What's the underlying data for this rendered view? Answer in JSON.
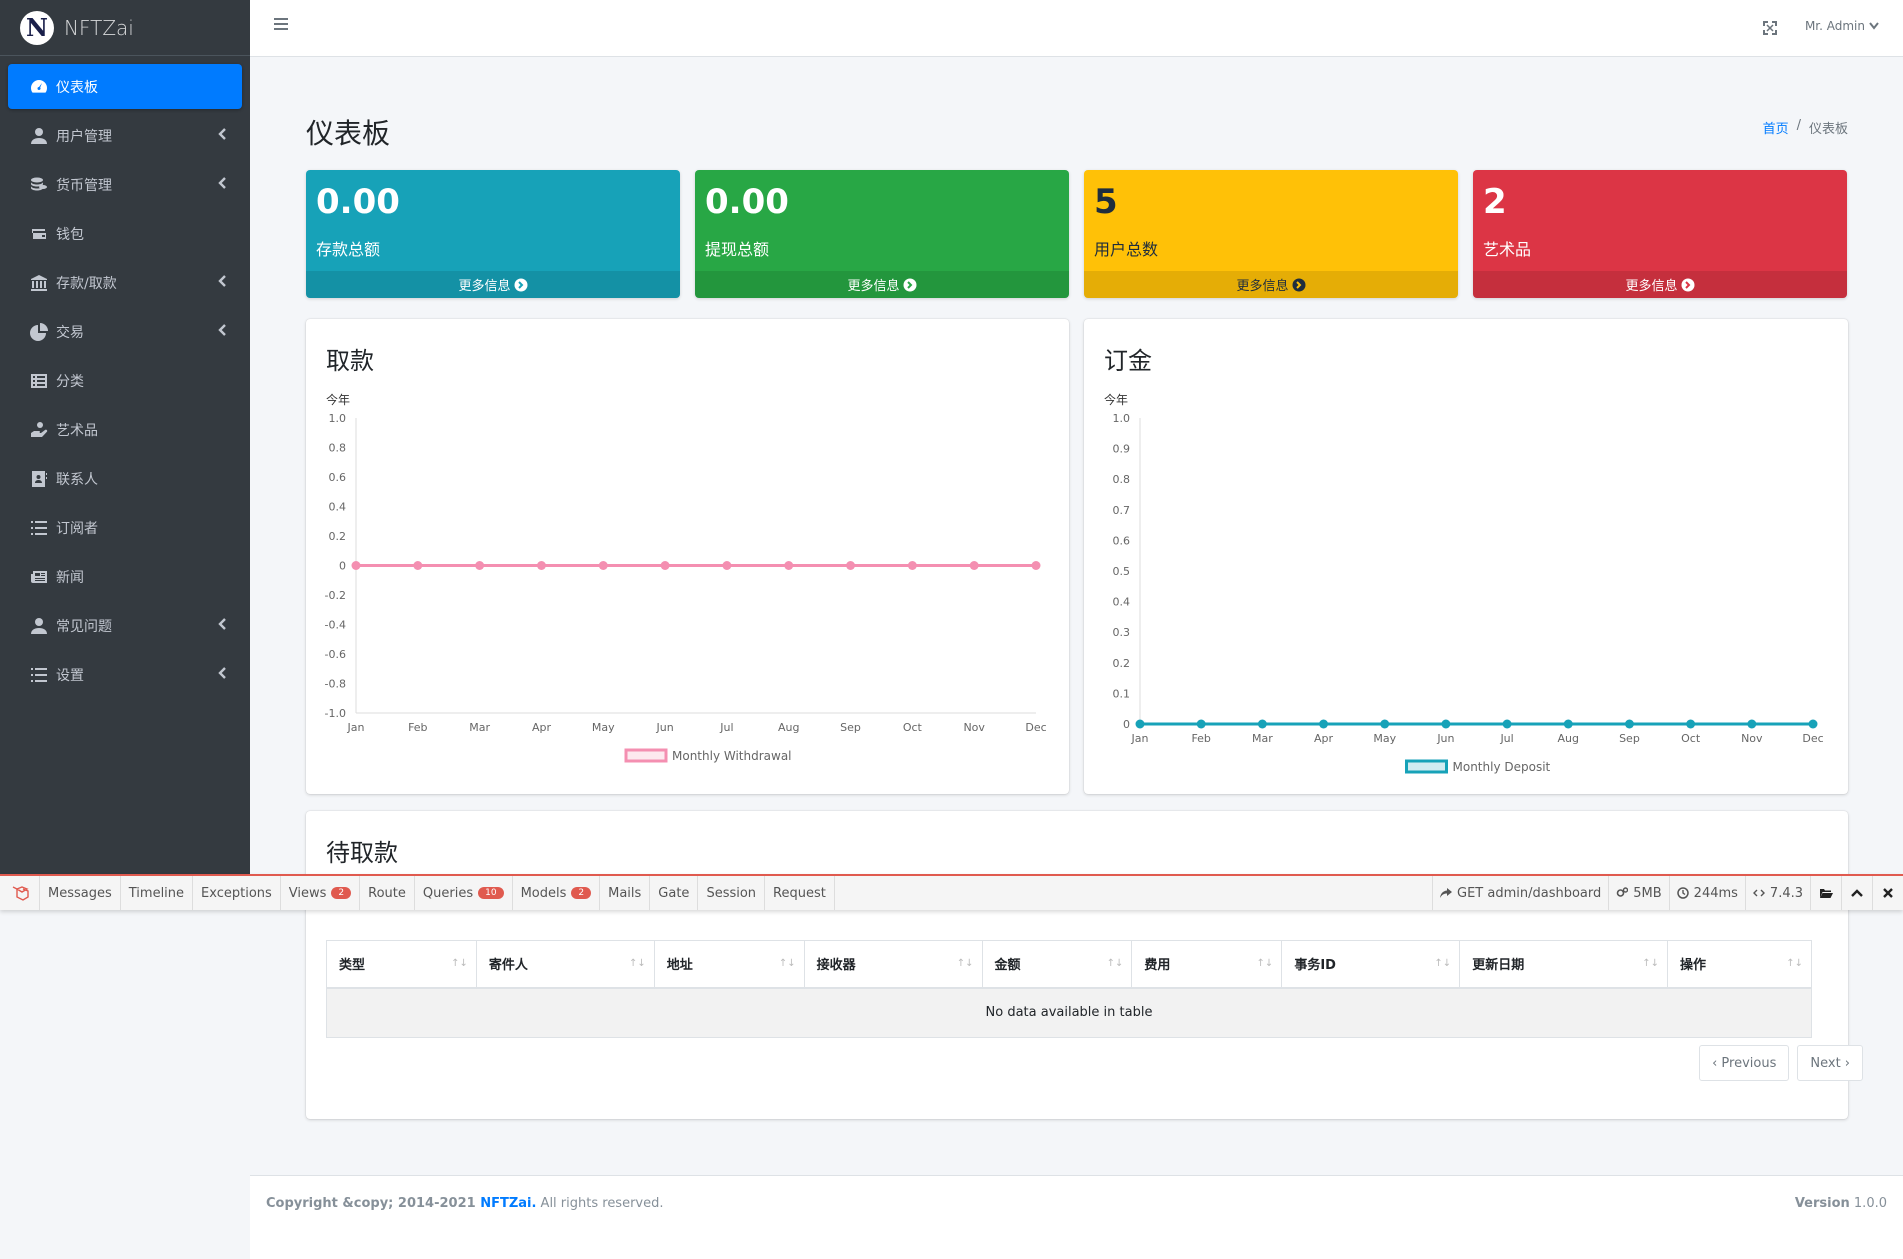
{
  "brand": {
    "logo_letter": "N",
    "name": "NFTZai"
  },
  "sidebar": {
    "items": [
      {
        "label": "仪表板",
        "icon": "tachometer-icon",
        "active": true,
        "arrow": false
      },
      {
        "label": "用户管理",
        "icon": "user-icon",
        "active": false,
        "arrow": true
      },
      {
        "label": "货币管理",
        "icon": "coins-icon",
        "active": false,
        "arrow": true
      },
      {
        "label": "钱包",
        "icon": "wallet-icon",
        "active": false,
        "arrow": false
      },
      {
        "label": "存款/取款",
        "icon": "bank-icon",
        "active": false,
        "arrow": true
      },
      {
        "label": "交易",
        "icon": "chart-pie-icon",
        "active": false,
        "arrow": true
      },
      {
        "label": "分类",
        "icon": "list-alt-icon",
        "active": false,
        "arrow": false
      },
      {
        "label": "艺术品",
        "icon": "hand-holding-icon",
        "active": false,
        "arrow": false
      },
      {
        "label": "联系人",
        "icon": "address-book-icon",
        "active": false,
        "arrow": false
      },
      {
        "label": "订阅者",
        "icon": "list-icon",
        "active": false,
        "arrow": false
      },
      {
        "label": "新闻",
        "icon": "newspaper-icon",
        "active": false,
        "arrow": false
      },
      {
        "label": "常见问题",
        "icon": "user-icon",
        "active": false,
        "arrow": true
      },
      {
        "label": "设置",
        "icon": "list-icon",
        "active": false,
        "arrow": true
      }
    ]
  },
  "topbar": {
    "admin_label": "Mr. Admin"
  },
  "page": {
    "title": "仪表板",
    "breadcrumb_home": "首页",
    "breadcrumb_sep": "/",
    "breadcrumb_current": "仪表板"
  },
  "boxes": [
    {
      "value": "0.00",
      "label": "存款总额",
      "footer": "更多信息",
      "color": "#17a2b8"
    },
    {
      "value": "0.00",
      "label": "提现总额",
      "footer": "更多信息",
      "color": "#28a745"
    },
    {
      "value": "5",
      "label": "用户总数",
      "footer": "更多信息",
      "color": "#ffc107"
    },
    {
      "value": "2",
      "label": "艺术品",
      "footer": "更多信息",
      "color": "#dc3545"
    }
  ],
  "withdraw_card": {
    "title": "取款"
  },
  "deposit_card": {
    "title": "订金"
  },
  "chart_data": [
    {
      "type": "line",
      "title": "今年",
      "categories": [
        "Jan",
        "Feb",
        "Mar",
        "Apr",
        "May",
        "Jun",
        "Jul",
        "Aug",
        "Sep",
        "Oct",
        "Nov",
        "Dec"
      ],
      "series": [
        {
          "name": "Monthly Withdrawal",
          "values": [
            0,
            0,
            0,
            0,
            0,
            0,
            0,
            0,
            0,
            0,
            0,
            0
          ],
          "color": "#f48fb1"
        }
      ],
      "ylim": [
        -1.0,
        1.0
      ],
      "yticks": [
        "1.0",
        "0.8",
        "0.6",
        "0.4",
        "0.2",
        "0",
        "-0.2",
        "-0.4",
        "-0.6",
        "-0.8",
        "-1.0"
      ],
      "legend": "bottom"
    },
    {
      "type": "line",
      "title": "今年",
      "categories": [
        "Jan",
        "Feb",
        "Mar",
        "Apr",
        "May",
        "Jun",
        "Jul",
        "Aug",
        "Sep",
        "Oct",
        "Nov",
        "Dec"
      ],
      "series": [
        {
          "name": "Monthly Deposit",
          "values": [
            0,
            0,
            0,
            0,
            0,
            0,
            0,
            0,
            0,
            0,
            0,
            0
          ],
          "color": "#17a2b8"
        }
      ],
      "ylim": [
        0,
        1.0
      ],
      "yticks": [
        "1.0",
        "0.9",
        "0.8",
        "0.7",
        "0.6",
        "0.5",
        "0.4",
        "0.3",
        "0.2",
        "0.1",
        "0"
      ],
      "legend": "bottom"
    }
  ],
  "pending_card": {
    "title": "待取款"
  },
  "debugbar": {
    "tabs": [
      {
        "label": "Messages",
        "badge": ""
      },
      {
        "label": "Timeline",
        "badge": ""
      },
      {
        "label": "Exceptions",
        "badge": ""
      },
      {
        "label": "Views",
        "badge": "2"
      },
      {
        "label": "Route",
        "badge": ""
      },
      {
        "label": "Queries",
        "badge": "10"
      },
      {
        "label": "Models",
        "badge": "2"
      },
      {
        "label": "Mails",
        "badge": ""
      },
      {
        "label": "Gate",
        "badge": ""
      },
      {
        "label": "Session",
        "badge": ""
      },
      {
        "label": "Request",
        "badge": ""
      }
    ],
    "request": "GET admin/dashboard",
    "memory": "5MB",
    "time": "244ms",
    "php": "7.4.3"
  },
  "table": {
    "columns": [
      "类型",
      "寄件人",
      "地址",
      "接收器",
      "金额",
      "费用",
      "事务ID",
      "更新日期",
      "操作"
    ],
    "empty_text": "No data available in table",
    "prev": "‹ Previous",
    "next": "Next ›"
  },
  "footer": {
    "copyright_prefix": "Copyright &copy; 2014-2021 ",
    "brand": "NFTZai.",
    "rights": " All rights reserved.",
    "version_label": "Version",
    "version": " 1.0.0"
  }
}
